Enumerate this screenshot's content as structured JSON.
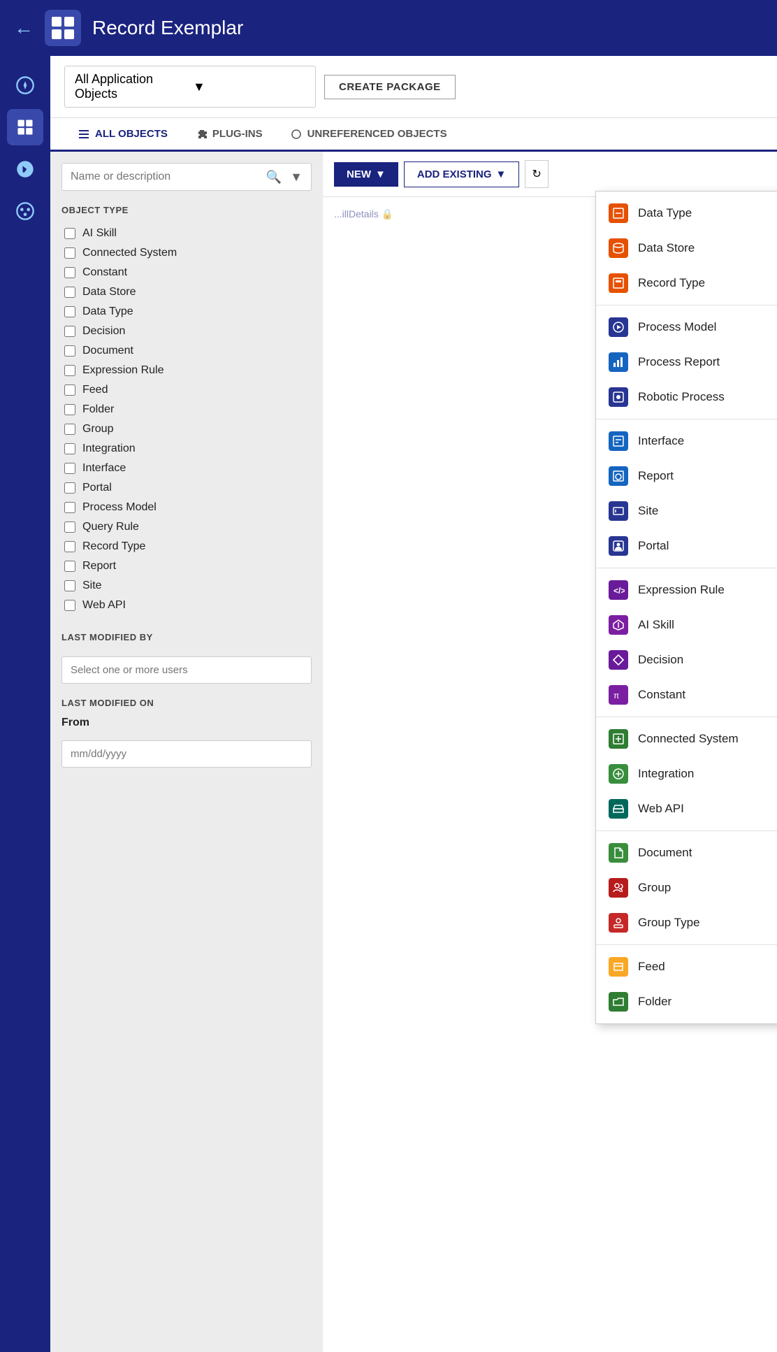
{
  "header": {
    "back_label": "←",
    "app_icon_alt": "record-exemplar-icon",
    "title": "Record Exemplar"
  },
  "sidebar": {
    "items": [
      {
        "name": "compass",
        "icon": "compass",
        "active": false
      },
      {
        "name": "objects",
        "icon": "grid",
        "active": true
      },
      {
        "name": "deploy",
        "icon": "rocket",
        "active": false
      },
      {
        "name": "palette",
        "icon": "palette",
        "active": false
      }
    ]
  },
  "toolbar": {
    "dropdown_label": "All Application Objects",
    "create_package_label": "CREATE PACKAGE"
  },
  "tabs": [
    {
      "id": "all-objects",
      "label": "ALL OBJECTS",
      "active": true,
      "icon": "list"
    },
    {
      "id": "plug-ins",
      "label": "PLUG-INS",
      "active": false,
      "icon": "puzzle"
    },
    {
      "id": "unreferenced",
      "label": "UNREFERENCED OBJECTS",
      "active": false,
      "icon": "circle"
    }
  ],
  "search": {
    "placeholder": "Name or description"
  },
  "filter": {
    "object_type_title": "OBJECT TYPE",
    "checkboxes": [
      "AI Skill",
      "Connected System",
      "Constant",
      "Data Store",
      "Data Type",
      "Decision",
      "Document",
      "Expression Rule",
      "Feed",
      "Folder",
      "Group",
      "Integration",
      "Interface",
      "Portal",
      "Process Model",
      "Query Rule",
      "Record Type",
      "Report",
      "Site",
      "Web API"
    ],
    "last_modified_by_title": "LAST MODIFIED BY",
    "users_placeholder": "Select one or more users",
    "last_modified_on_title": "LAST MODIFIED ON",
    "from_label": "From",
    "date_placeholder": "mm/dd/yyyy"
  },
  "new_button": "NEW",
  "add_existing_button": "ADD EXISTING",
  "dropdown_menu": {
    "sections": [
      {
        "items": [
          {
            "label": "Data Type",
            "icon_type": "icon-orange",
            "icon_symbol": "dt"
          },
          {
            "label": "Data Store",
            "icon_type": "icon-orange",
            "icon_symbol": "ds"
          },
          {
            "label": "Record Type",
            "icon_type": "icon-orange",
            "icon_symbol": "rt"
          }
        ]
      },
      {
        "items": [
          {
            "label": "Process Model",
            "icon_type": "icon-blue",
            "icon_symbol": "pm"
          },
          {
            "label": "Process Report",
            "icon_type": "icon-blue2",
            "icon_symbol": "pr"
          },
          {
            "label": "Robotic Process",
            "icon_type": "icon-blue",
            "icon_symbol": "rp"
          }
        ]
      },
      {
        "items": [
          {
            "label": "Interface",
            "icon_type": "icon-blue2",
            "icon_symbol": "if"
          },
          {
            "label": "Report",
            "icon_type": "icon-blue2",
            "icon_symbol": "rpt"
          },
          {
            "label": "Site",
            "icon_type": "icon-blue",
            "icon_symbol": "st"
          },
          {
            "label": "Portal",
            "icon_type": "icon-blue",
            "icon_symbol": "ptl"
          }
        ]
      },
      {
        "items": [
          {
            "label": "Expression Rule",
            "icon_type": "icon-purple",
            "icon_symbol": "er"
          },
          {
            "label": "AI Skill",
            "icon_type": "icon-purple2",
            "icon_symbol": "ai"
          },
          {
            "label": "Decision",
            "icon_type": "icon-purple",
            "icon_symbol": "dc"
          },
          {
            "label": "Constant",
            "icon_type": "icon-purple2",
            "icon_symbol": "cn"
          }
        ]
      },
      {
        "items": [
          {
            "label": "Connected System",
            "icon_type": "icon-green",
            "icon_symbol": "cs"
          },
          {
            "label": "Integration",
            "icon_type": "icon-green2",
            "icon_symbol": "int"
          },
          {
            "label": "Web API",
            "icon_type": "icon-teal",
            "icon_symbol": "wa"
          }
        ]
      },
      {
        "items": [
          {
            "label": "Document",
            "icon_type": "icon-green2",
            "icon_symbol": "doc"
          },
          {
            "label": "Group",
            "icon_type": "icon-red",
            "icon_symbol": "grp"
          },
          {
            "label": "Group Type",
            "icon_type": "icon-red2",
            "icon_symbol": "gt"
          }
        ]
      },
      {
        "items": [
          {
            "label": "Feed",
            "icon_type": "icon-yellow",
            "icon_symbol": "fd"
          },
          {
            "label": "Folder",
            "icon_type": "icon-green",
            "icon_symbol": "fldr"
          }
        ]
      }
    ]
  }
}
